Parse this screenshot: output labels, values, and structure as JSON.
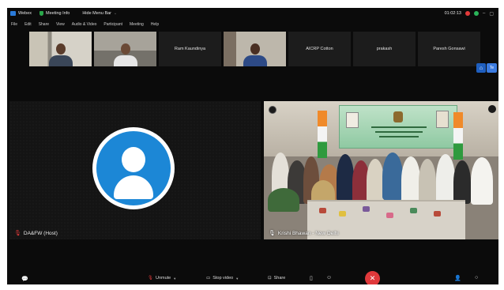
{
  "titlebar": {
    "app_name": "Webex",
    "meeting_info": "Meeting Info",
    "hide_menu": "Hide Menu Bar",
    "timer": "01:02:13"
  },
  "menubar": {
    "items": [
      "File",
      "Edit",
      "Share",
      "View",
      "Audio & Video",
      "Participant",
      "Meeting",
      "Help"
    ]
  },
  "thumbnails": [
    {
      "name": "",
      "type": "video"
    },
    {
      "name": "",
      "type": "video"
    },
    {
      "name": "Ram Kaundinya",
      "type": "name"
    },
    {
      "name": "",
      "type": "video"
    },
    {
      "name": "AICRP Cotton",
      "type": "name"
    },
    {
      "name": "prakash",
      "type": "name"
    },
    {
      "name": "Paresh Gonsawi",
      "type": "name"
    }
  ],
  "side_button": {
    "label": "Te"
  },
  "main_left": {
    "name": "DA&FW (Host)"
  },
  "main_right": {
    "name": "Krishi Bhawan - New Delhi"
  },
  "bottombar": {
    "unmute": "Unmute",
    "stop_video": "Stop video",
    "share": "Share"
  },
  "colors": {
    "leave": "#e0393b",
    "avatar": "#1c87d6",
    "accent": "#3b7be0"
  }
}
